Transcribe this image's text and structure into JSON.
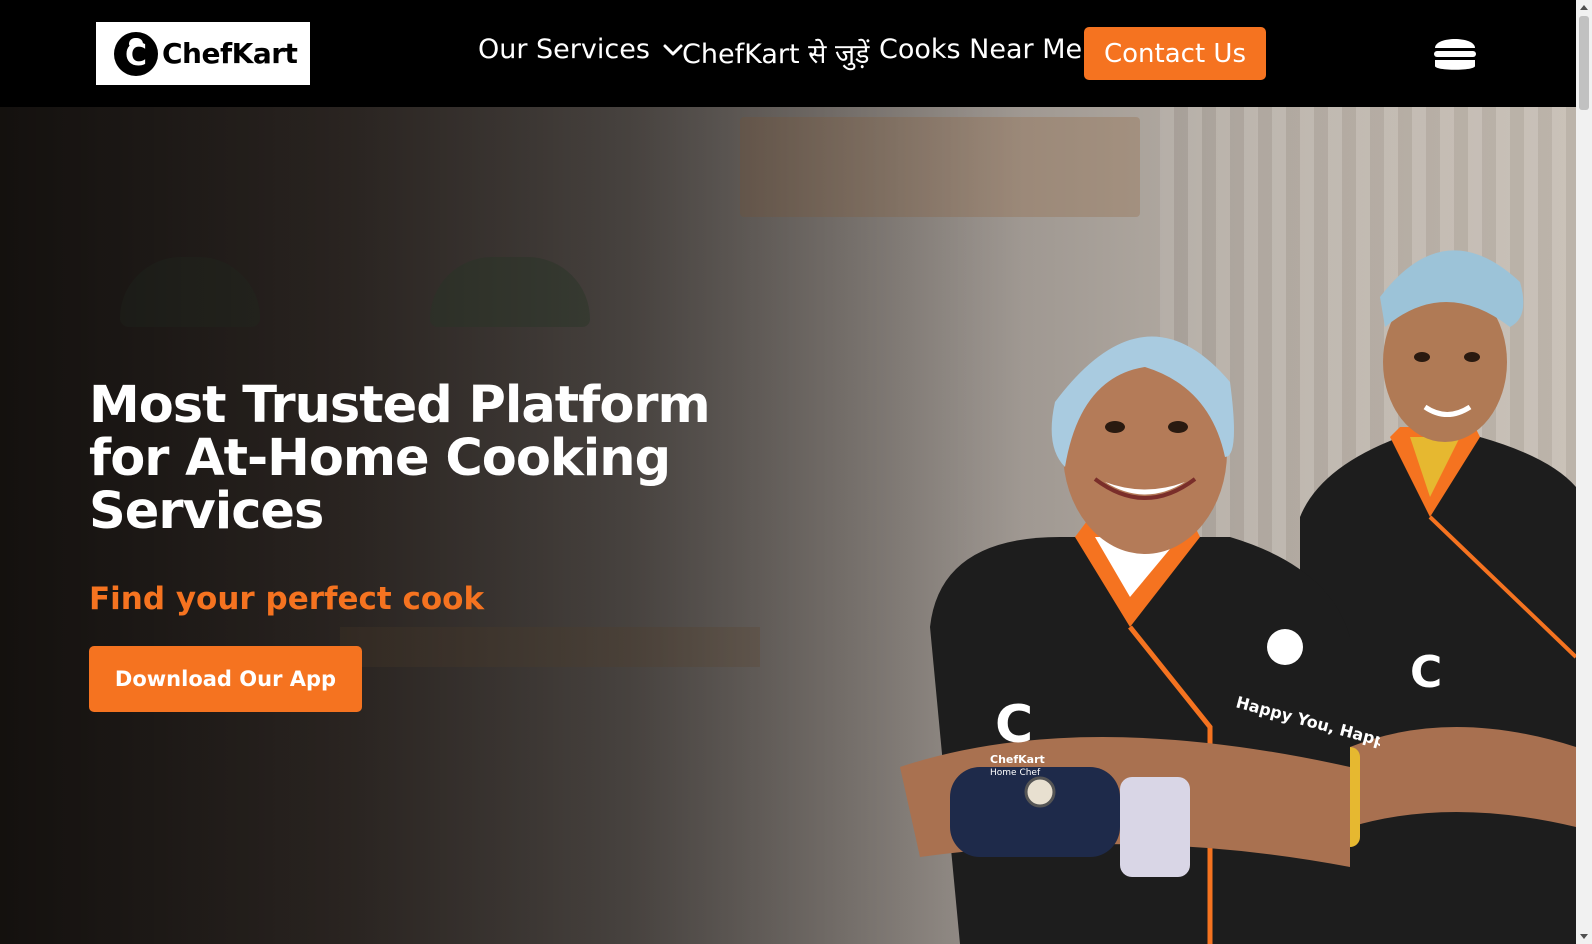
{
  "brand": {
    "name": "ChefKart",
    "logo_letter": "C"
  },
  "nav": {
    "services": "Our Services",
    "join": "ChefKart से जुड़ें",
    "cooks_near_me": "Cooks Near Me",
    "contact": "Contact Us"
  },
  "hero": {
    "title_line1": "Most Trusted Platform",
    "title_line2": "for At-Home Cooking",
    "title_line3": "Services",
    "subtitle": "Find your perfect cook",
    "cta": "Download Our App"
  },
  "chef_uniform": {
    "label1": "ChefKart",
    "label2": "Home Chef",
    "sleeve_text": "Happy You, Happy Us"
  },
  "colors": {
    "accent": "#f57320",
    "nav_bg": "#000000"
  },
  "icons": [
    "chevron-down-icon",
    "hamburger-menu-icon",
    "chefkart-logo-icon"
  ]
}
